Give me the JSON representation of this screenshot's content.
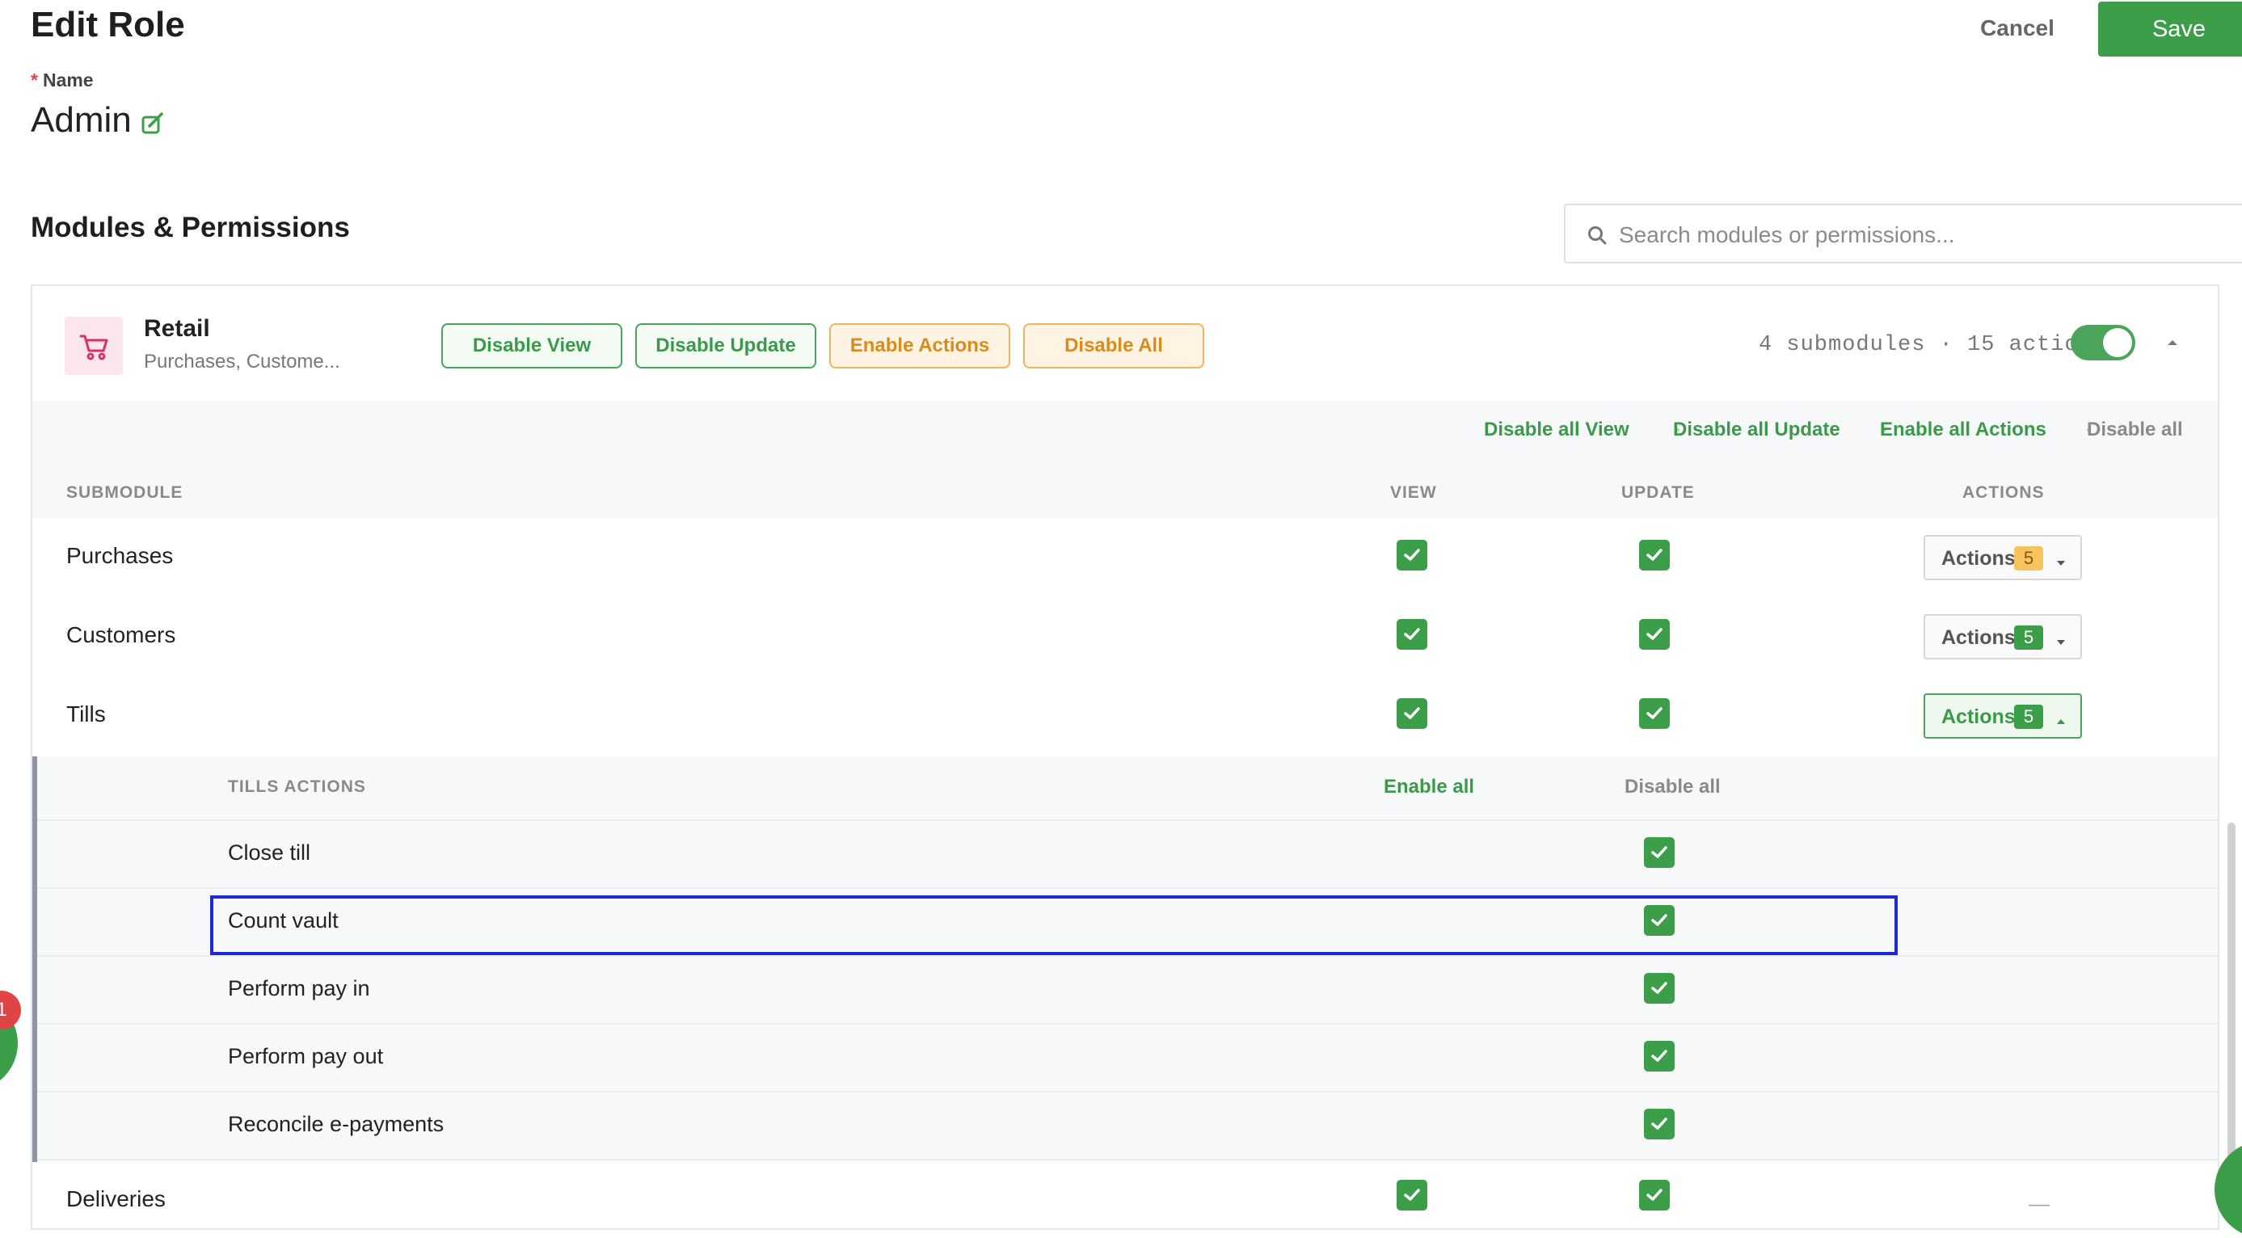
{
  "header": {
    "title": "Edit Role",
    "cancel_label": "Cancel",
    "save_label": "Save"
  },
  "name_field": {
    "required_mark": "*",
    "label": "Name",
    "value": "Admin"
  },
  "section_title": "Modules & Permissions",
  "search": {
    "placeholder": "Search modules or permissions..."
  },
  "module": {
    "name": "Retail",
    "subtitle": "Purchases, Custome...",
    "buttons": {
      "disable_view": "Disable View",
      "disable_update": "Disable Update",
      "enable_actions": "Enable Actions",
      "disable_all": "Disable All"
    },
    "counts": "4 submodules · 15 actions",
    "enabled": true
  },
  "bulk_links": {
    "disable_all_view": "Disable all View",
    "disable_all_update": "Disable all Update",
    "enable_all_actions": "Enable all Actions",
    "disable_all": "Disable all"
  },
  "columns": {
    "submodule": "SUBMODULE",
    "view": "VIEW",
    "update": "UPDATE",
    "actions": "ACTIONS"
  },
  "submodules": [
    {
      "name": "Purchases",
      "view": true,
      "update": true,
      "actions_label": "Actions",
      "actions_count": "5"
    },
    {
      "name": "Customers",
      "view": true,
      "update": true,
      "actions_label": "Actions",
      "actions_count": "5"
    },
    {
      "name": "Tills",
      "view": true,
      "update": true,
      "actions_label": "Actions",
      "actions_count": "5"
    },
    {
      "name": "Deliveries",
      "view": true,
      "update": true,
      "actions_label": "—"
    }
  ],
  "tills_actions": {
    "title": "TILLS ACTIONS",
    "enable_all": "Enable all",
    "disable_all": "Disable all",
    "items": [
      {
        "name": "Close till",
        "enabled": true
      },
      {
        "name": "Count vault",
        "enabled": true
      },
      {
        "name": "Perform pay in",
        "enabled": true
      },
      {
        "name": "Perform pay out",
        "enabled": true
      },
      {
        "name": "Reconcile e-payments",
        "enabled": true
      }
    ]
  },
  "notification_count": "1",
  "colors": {
    "accent_green": "#3d9e49",
    "warning_orange": "#d98b1d",
    "focus_blue": "#1a2bd4"
  },
  "icons": [
    "edit-icon",
    "search-icon",
    "cart-icon",
    "chevron-up-icon",
    "chevron-down-icon",
    "checkbox-checked-icon"
  ]
}
